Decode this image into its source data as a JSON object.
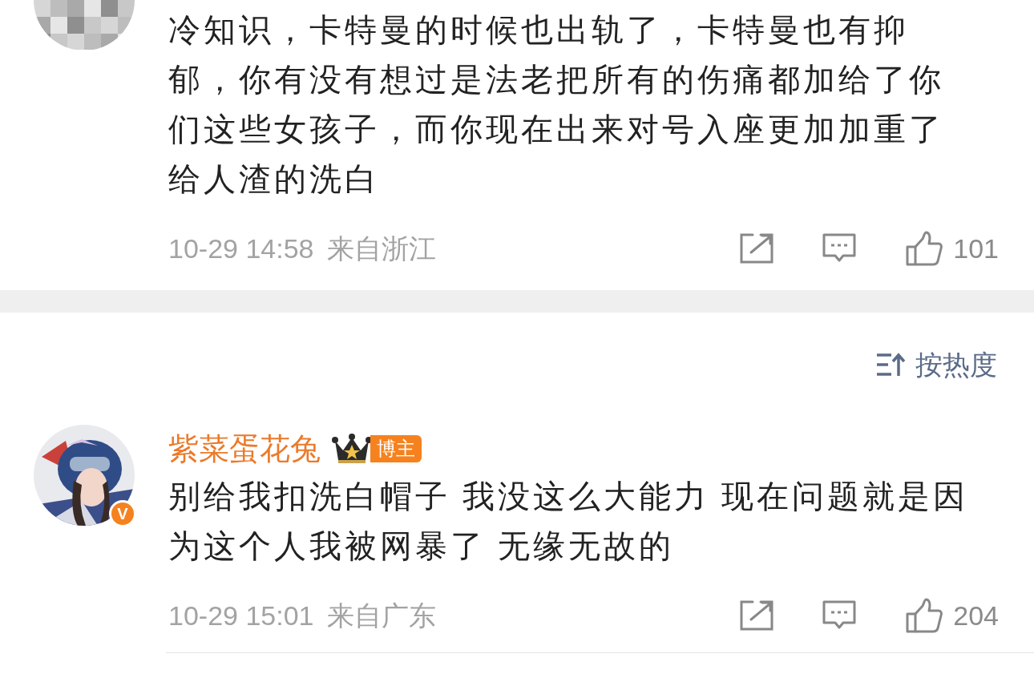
{
  "comments": [
    {
      "kind": "reply",
      "text": "冷知识，卡特曼的时候也出轨了，卡特曼也有抑郁，你有没有想过是法老把所有的伤痛都加给了你们这些女孩子，而你现在出来对号入座更加加重了给人渣的洗白",
      "time": "10-29 14:58",
      "location": "来自浙江",
      "likes": "101"
    },
    {
      "kind": "author",
      "verified_mark": "V",
      "name": "紫菜蛋花兔",
      "badge": "博主",
      "text": "别给我扣洗白帽子 我没这么大能力 现在问题就是因为这个人我被网暴了 无缘无故的",
      "time": "10-29 15:01",
      "location": "来自广东",
      "likes": "204"
    }
  ],
  "sort": {
    "label": "按热度"
  }
}
